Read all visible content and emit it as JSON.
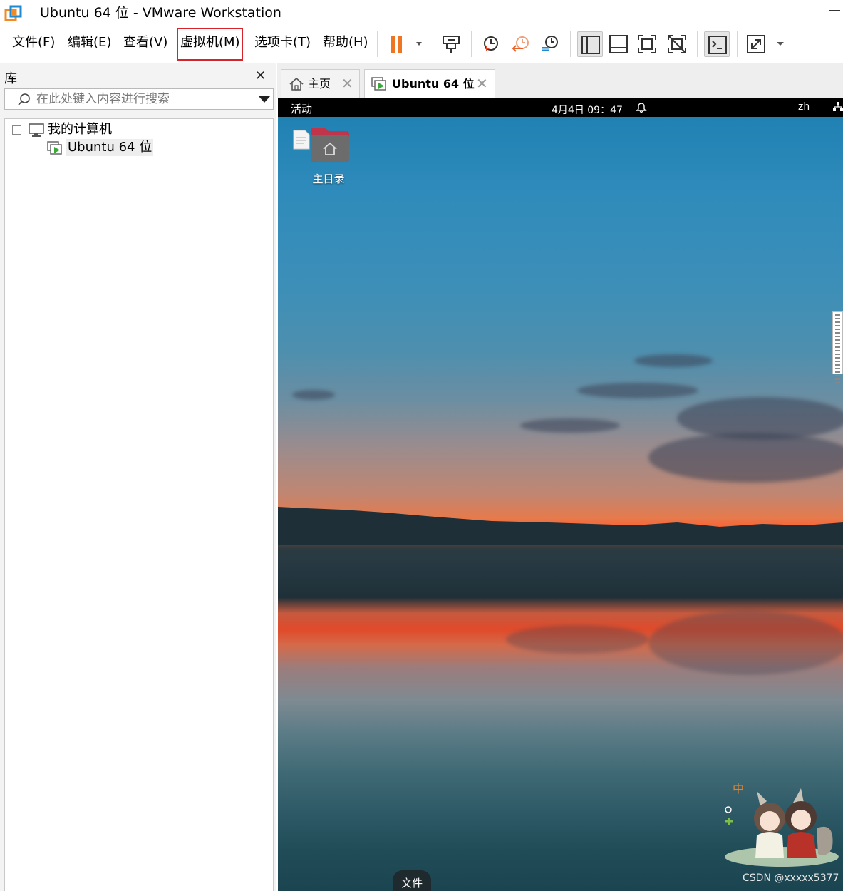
{
  "window": {
    "title": "Ubuntu 64 位 - VMware Workstation"
  },
  "menu": {
    "file": "文件(F)",
    "edit": "编辑(E)",
    "view": "查看(V)",
    "vm": "虚拟机(M)",
    "tabs": "选项卡(T)",
    "help": "帮助(H)"
  },
  "toolbar": {
    "icons": [
      "pause-icon",
      "dropdown-arrow-icon",
      "send-ctrl-alt-del-icon",
      "snapshot-icon",
      "revert-snapshot-icon",
      "snapshot-manager-icon",
      "show-library-icon",
      "show-thumbnail-bar-icon",
      "fullscreen-icon",
      "unity-icon",
      "console-view-icon",
      "stretch-icon"
    ]
  },
  "library": {
    "title": "库",
    "close": "✕",
    "search_placeholder": "在此处键入内容进行搜索",
    "tree_root": "我的计算机",
    "tree_vm": "Ubuntu 64 位"
  },
  "tabs": {
    "home": "主页",
    "vm": "Ubuntu 64 位"
  },
  "guest": {
    "activities": "活动",
    "clock": "4月4日  09：47",
    "lang": "zh",
    "desktop_icon_label": "主目录",
    "dock_label": "文件"
  },
  "watermark": "CSDN @xxxxx5377",
  "colors": {
    "highlight": "#d9232a",
    "pause": "#f07522",
    "topbar": "#000000"
  }
}
